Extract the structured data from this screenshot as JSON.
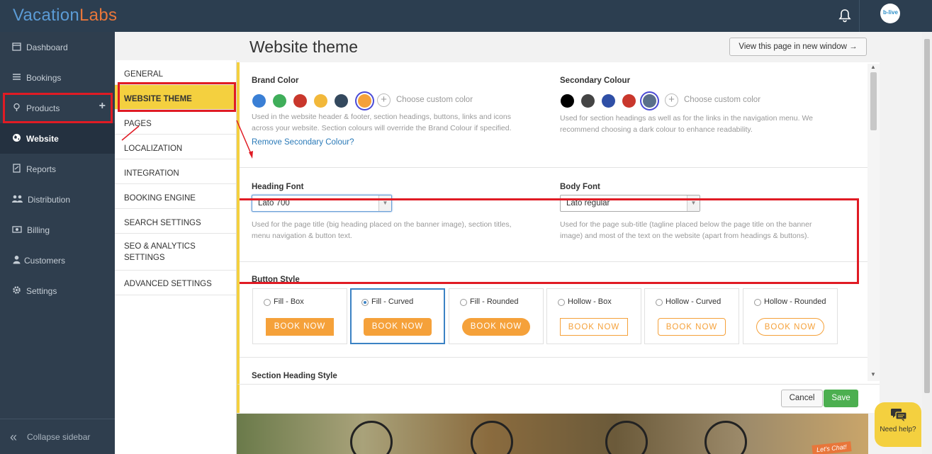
{
  "app": {
    "logo_part1": "Vacation",
    "logo_part2": "Labs",
    "avatar_text": "b-live"
  },
  "sidebar": {
    "items": [
      {
        "label": "Dashboard",
        "icon": "calendar-icon"
      },
      {
        "label": "Bookings",
        "icon": "list-icon"
      },
      {
        "label": "Products",
        "icon": "lightbulb-icon"
      },
      {
        "label": "Website",
        "icon": "globe-icon"
      },
      {
        "label": "Reports",
        "icon": "report-icon"
      },
      {
        "label": "Distribution",
        "icon": "users-icon"
      },
      {
        "label": "Billing",
        "icon": "money-icon"
      },
      {
        "label": "Customers",
        "icon": "user-icon"
      },
      {
        "label": "Settings",
        "icon": "gear-icon"
      }
    ],
    "products_add": "+",
    "collapse_label": "Collapse sidebar",
    "collapse_icon": "«"
  },
  "subnav": {
    "items": [
      "GENERAL",
      "WEBSITE THEME",
      "PAGES",
      "LOCALIZATION",
      "INTEGRATION",
      "BOOKING ENGINE",
      "SEARCH SETTINGS",
      "SEO & ANALYTICS SETTINGS",
      "ADVANCED SETTINGS"
    ]
  },
  "main": {
    "title": "Website theme",
    "view_button": "View this page in new window →"
  },
  "brand_color": {
    "title": "Brand Color",
    "swatches": [
      "#3a7fd5",
      "#3fae5a",
      "#c9372c",
      "#f2b83a",
      "#34495e",
      "#f5a13a"
    ],
    "selected_index": 5,
    "custom_label": "Choose custom color",
    "plus": "+",
    "help": "Used in the website header & footer, section headings, buttons, links and icons across your website. Section colours will override the Brand Colour if specified.",
    "remove_link": "Remove Secondary Colour?"
  },
  "secondary_color": {
    "title": "Secondary Colour",
    "swatches": [
      "#000000",
      "#444444",
      "#2f4fa6",
      "#c9372c",
      "#5a6f8a"
    ],
    "selected_index": 4,
    "custom_label": "Choose custom color",
    "plus": "+",
    "help": "Used for section headings as well as for the links in the navigation menu. We recommend choosing a dark colour to enhance readability."
  },
  "heading_font": {
    "title": "Heading Font",
    "value": "Lato 700",
    "help": "Used for the page title (big heading placed on the banner image), section titles, menu navigation & button text."
  },
  "body_font": {
    "title": "Body Font",
    "value": "Lato regular",
    "help": "Used for the page sub-title (tagline placed below the page title on the banner image) and most of the text on the website (apart from headings & buttons)."
  },
  "button_style": {
    "title": "Button Style",
    "options": [
      {
        "label": "Fill - Box",
        "kind": "fill",
        "shape": "box",
        "selected": false
      },
      {
        "label": "Fill - Curved",
        "kind": "fill",
        "shape": "curved",
        "selected": true
      },
      {
        "label": "Fill - Rounded",
        "kind": "fill",
        "shape": "rounded",
        "selected": false
      },
      {
        "label": "Hollow - Box",
        "kind": "hollow",
        "shape": "box",
        "selected": false
      },
      {
        "label": "Hollow - Curved",
        "kind": "hollow",
        "shape": "curved",
        "selected": false
      },
      {
        "label": "Hollow - Rounded",
        "kind": "hollow",
        "shape": "rounded",
        "selected": false
      }
    ],
    "preview_label": "BOOK NOW"
  },
  "section_heading": {
    "title": "Section Heading Style"
  },
  "footer": {
    "cancel": "Cancel",
    "save": "Save"
  },
  "banner": {
    "chat_text": "Let's Chat!"
  },
  "help_widget": {
    "label": "Need help?"
  },
  "colors": {
    "accent_yellow": "#f4d03f",
    "highlight_red": "#e01b24",
    "sidebar_bg": "#2f3e4e",
    "topbar_bg": "#2c3e50",
    "save_green": "#4caf50",
    "orange": "#f5a13a"
  }
}
